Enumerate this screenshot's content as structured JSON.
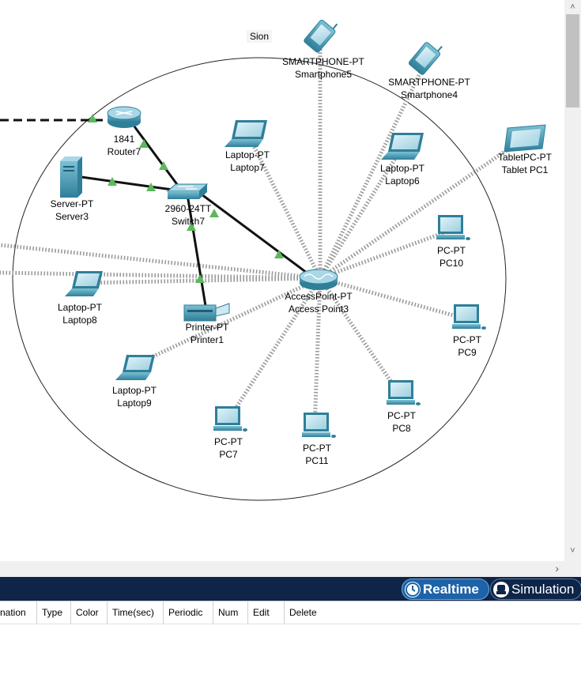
{
  "workspace": {
    "area_note": "Sion",
    "devices": [
      {
        "id": "router7",
        "type": "1841",
        "name": "Router7"
      },
      {
        "id": "switch7",
        "type": "2960-24TT",
        "name": "Switch7"
      },
      {
        "id": "server3",
        "type": "Server-PT",
        "name": "Server3"
      },
      {
        "id": "printer1",
        "type": "Printer-PT",
        "name": "Printer1"
      },
      {
        "id": "ap3",
        "type": "AccessPoint-PT",
        "name": "Access Point3"
      },
      {
        "id": "laptop7",
        "type": "Laptop-PT",
        "name": "Laptop7"
      },
      {
        "id": "laptop6",
        "type": "Laptop-PT",
        "name": "Laptop6"
      },
      {
        "id": "laptop8",
        "type": "Laptop-PT",
        "name": "Laptop8"
      },
      {
        "id": "laptop9",
        "type": "Laptop-PT",
        "name": "Laptop9"
      },
      {
        "id": "smartphone5",
        "type": "SMARTPHONE-PT",
        "name": "Smartphone5"
      },
      {
        "id": "smartphone4",
        "type": "SMARTPHONE-PT",
        "name": "Smartphone4"
      },
      {
        "id": "tablet1",
        "type": "TabletPC-PT",
        "name": "Tablet PC1"
      },
      {
        "id": "pc10",
        "type": "PC-PT",
        "name": "PC10"
      },
      {
        "id": "pc9",
        "type": "PC-PT",
        "name": "PC9"
      },
      {
        "id": "pc8",
        "type": "PC-PT",
        "name": "PC8"
      },
      {
        "id": "pc11",
        "type": "PC-PT",
        "name": "PC11"
      },
      {
        "id": "pc7",
        "type": "PC-PT",
        "name": "PC7"
      }
    ]
  },
  "mode_bar": {
    "realtime": "Realtime",
    "simulation": "Simulation",
    "active": "Realtime"
  },
  "pdu_table": {
    "columns": [
      "nation",
      "Type",
      "Color",
      "Time(sec)",
      "Periodic",
      "Num",
      "Edit",
      "Delete"
    ]
  },
  "scrollbars": {
    "up": "˄",
    "down": "˅",
    "right": "›"
  },
  "colors": {
    "link_up": "#5cb85c",
    "device_teal": "#3d8ea8",
    "mode_bar": "#0e2448",
    "realtime_active": "#1d63a8"
  }
}
